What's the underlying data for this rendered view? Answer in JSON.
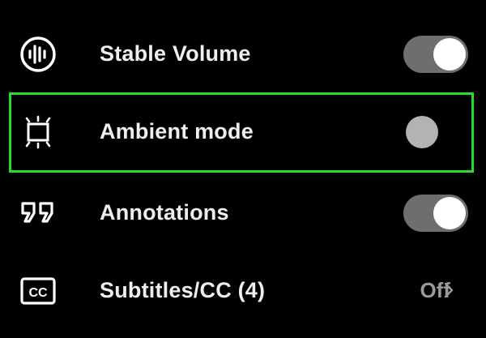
{
  "menu": {
    "items": [
      {
        "label": "Stable Volume",
        "icon": "stable-volume-icon",
        "control": "toggle",
        "state": "on"
      },
      {
        "label": "Ambient mode",
        "icon": "ambient-mode-icon",
        "control": "toggle",
        "state": "off"
      },
      {
        "label": "Annotations",
        "icon": "annotations-icon",
        "control": "toggle",
        "state": "on"
      },
      {
        "label": "Subtitles/CC (4)",
        "icon": "subtitles-cc-icon",
        "control": "submenu",
        "value": "Off"
      }
    ]
  },
  "highlight": {
    "target": "Ambient mode",
    "color": "#22e02a"
  },
  "colors": {
    "background": "#000000",
    "text": "#eeeeee",
    "toggle_track_on": "#6e6e6e",
    "toggle_knob_on": "#ffffff",
    "toggle_knob_off": "#b3b3b3",
    "secondary_text": "#9a9a9a"
  }
}
